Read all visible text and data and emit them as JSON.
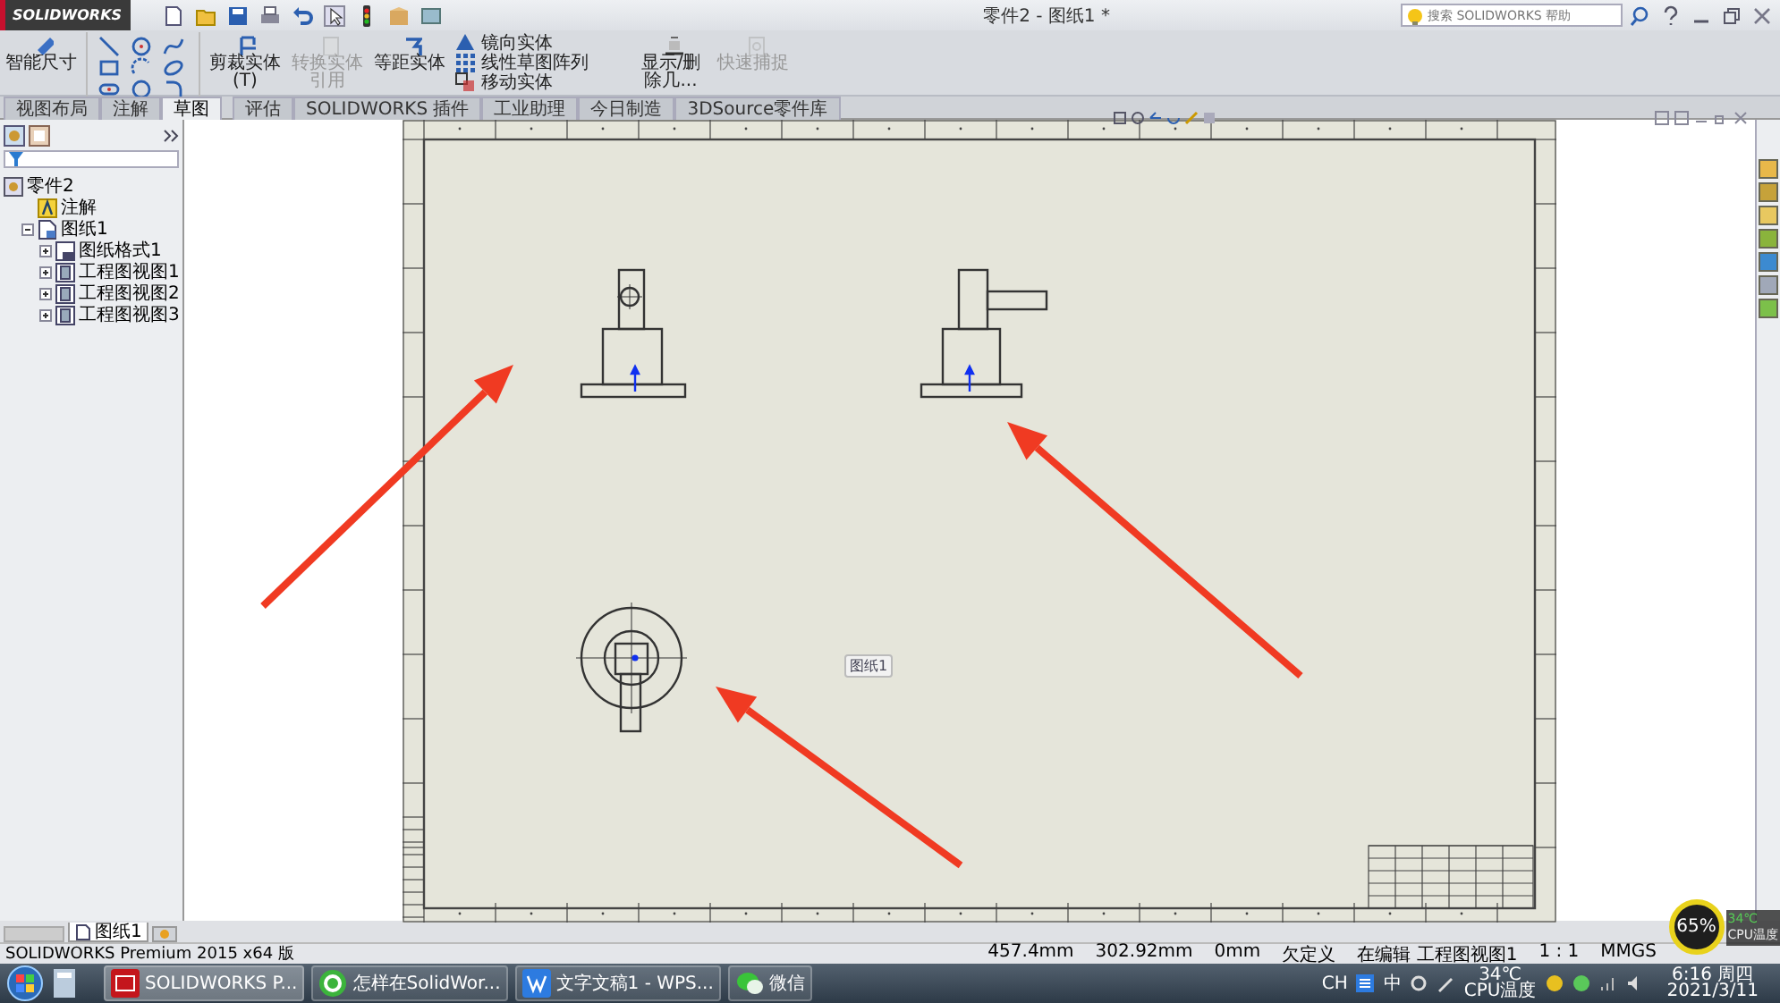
{
  "title_bar": {
    "logo": "SOLIDWORKS",
    "document_title": "零件2 - 图纸1 *",
    "search": {
      "placeholder": "搜索 SOLIDWORKS 帮助"
    }
  },
  "ribbon": [
    {
      "kind": "big",
      "label": "智能尺寸",
      "disabled": false
    },
    {
      "kind": "sketch-tools"
    },
    {
      "kind": "big",
      "label": "剪裁实体(T)",
      "disabled": false
    },
    {
      "kind": "big",
      "label": "转换实体引用",
      "disabled": true
    },
    {
      "kind": "big",
      "label": "等距实体",
      "disabled": false
    },
    {
      "kind": "list",
      "items": [
        "镜向实体",
        "线性草图阵列",
        "移动实体"
      ]
    },
    {
      "kind": "big",
      "label": "显示/删除几...",
      "disabled": false
    },
    {
      "kind": "big",
      "label": "快速捕捉",
      "disabled": true
    }
  ],
  "tabs": [
    {
      "label": "视图布局",
      "selected": false
    },
    {
      "label": "注解",
      "selected": false
    },
    {
      "label": "草图",
      "selected": true
    },
    {
      "label": "评估",
      "selected": false
    },
    {
      "label": "SOLIDWORKS 插件",
      "selected": false
    },
    {
      "label": "工业助理",
      "selected": false
    },
    {
      "label": "今日制造",
      "selected": false
    },
    {
      "label": "3DSource零件库",
      "selected": false
    }
  ],
  "tree": {
    "label": "零件2",
    "children": [
      {
        "label": "注解",
        "kind": "annotation"
      },
      {
        "label": "图纸1",
        "kind": "sheet",
        "expanded": true,
        "children": [
          {
            "label": "图纸格式1",
            "kind": "format",
            "expanded": false
          },
          {
            "label": "工程图视图1",
            "kind": "view",
            "expanded": false
          },
          {
            "label": "工程图视图2",
            "kind": "view",
            "expanded": false
          },
          {
            "label": "工程图视图3",
            "kind": "view",
            "expanded": false
          }
        ]
      }
    ]
  },
  "sheet_label": "图纸1",
  "sheet_tabs": [
    {
      "label": "图纸1",
      "selected": true
    }
  ],
  "status_bar": {
    "product": "SOLIDWORKS Premium 2015 x64 版",
    "fields": [
      "457.4mm",
      "302.92mm",
      "0mm",
      "欠定义",
      "在编辑 工程图视图1",
      "1 : 1",
      "MMGS"
    ]
  },
  "taskbar": {
    "tasks": [
      {
        "label": "SOLIDWORKS P...",
        "selected": true
      },
      {
        "label": "怎样在SolidWor...",
        "selected": false
      },
      {
        "label": "文字文稿1 - WPS...",
        "selected": false
      },
      {
        "label": "微信",
        "selected": false
      }
    ],
    "tray": {
      "input_language": "CH",
      "ime": "中",
      "temperature": "34℃",
      "temperature_label": "CPU温度",
      "time": "6:16 周四",
      "date": "2021/3/11"
    }
  },
  "cpu_widget": {
    "percent": "65%",
    "temperature": "34℃",
    "label": "CPU温度"
  }
}
